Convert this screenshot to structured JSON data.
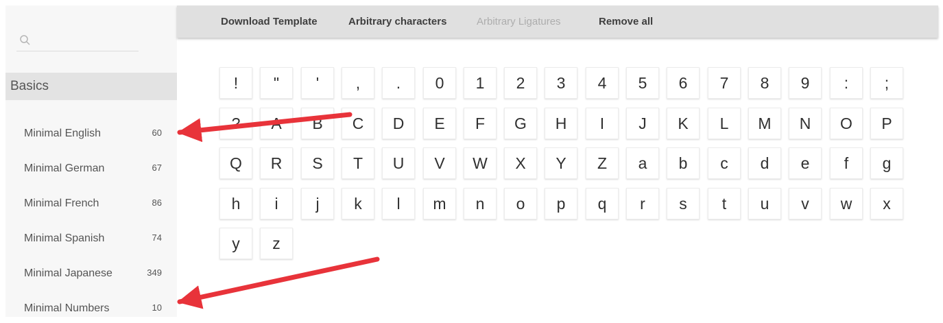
{
  "sidebar": {
    "search_placeholder": "",
    "section": "Basics",
    "sets": [
      {
        "name": "Minimal English",
        "count": "60"
      },
      {
        "name": "Minimal German",
        "count": "67"
      },
      {
        "name": "Minimal French",
        "count": "86"
      },
      {
        "name": "Minimal Spanish",
        "count": "74"
      },
      {
        "name": "Minimal Japanese",
        "count": "349"
      },
      {
        "name": "Minimal Numbers",
        "count": "10"
      }
    ]
  },
  "toolbar": {
    "download_template": "Download Template",
    "arbitrary_characters": "Arbitrary characters",
    "arbitrary_ligatures": "Arbitrary Ligatures",
    "remove_all": "Remove all"
  },
  "glyphs": [
    "!",
    "\"",
    "'",
    ",",
    ".",
    "0",
    "1",
    "2",
    "3",
    "4",
    "5",
    "6",
    "7",
    "8",
    "9",
    ":",
    ";",
    "?",
    "A",
    "B",
    "C",
    "D",
    "E",
    "F",
    "G",
    "H",
    "I",
    "J",
    "K",
    "L",
    "M",
    "N",
    "O",
    "P",
    "Q",
    "R",
    "S",
    "T",
    "U",
    "V",
    "W",
    "X",
    "Y",
    "Z",
    "a",
    "b",
    "c",
    "d",
    "e",
    "f",
    "g",
    "h",
    "i",
    "j",
    "k",
    "l",
    "m",
    "n",
    "o",
    "p",
    "q",
    "r",
    "s",
    "t",
    "u",
    "v",
    "w",
    "x",
    "y",
    "z"
  ],
  "colors": {
    "arrow": "#e8333a",
    "toolbar": "#e0e0e0",
    "sidebar": "#f7f7f7",
    "section_header": "#e3e3e3"
  }
}
